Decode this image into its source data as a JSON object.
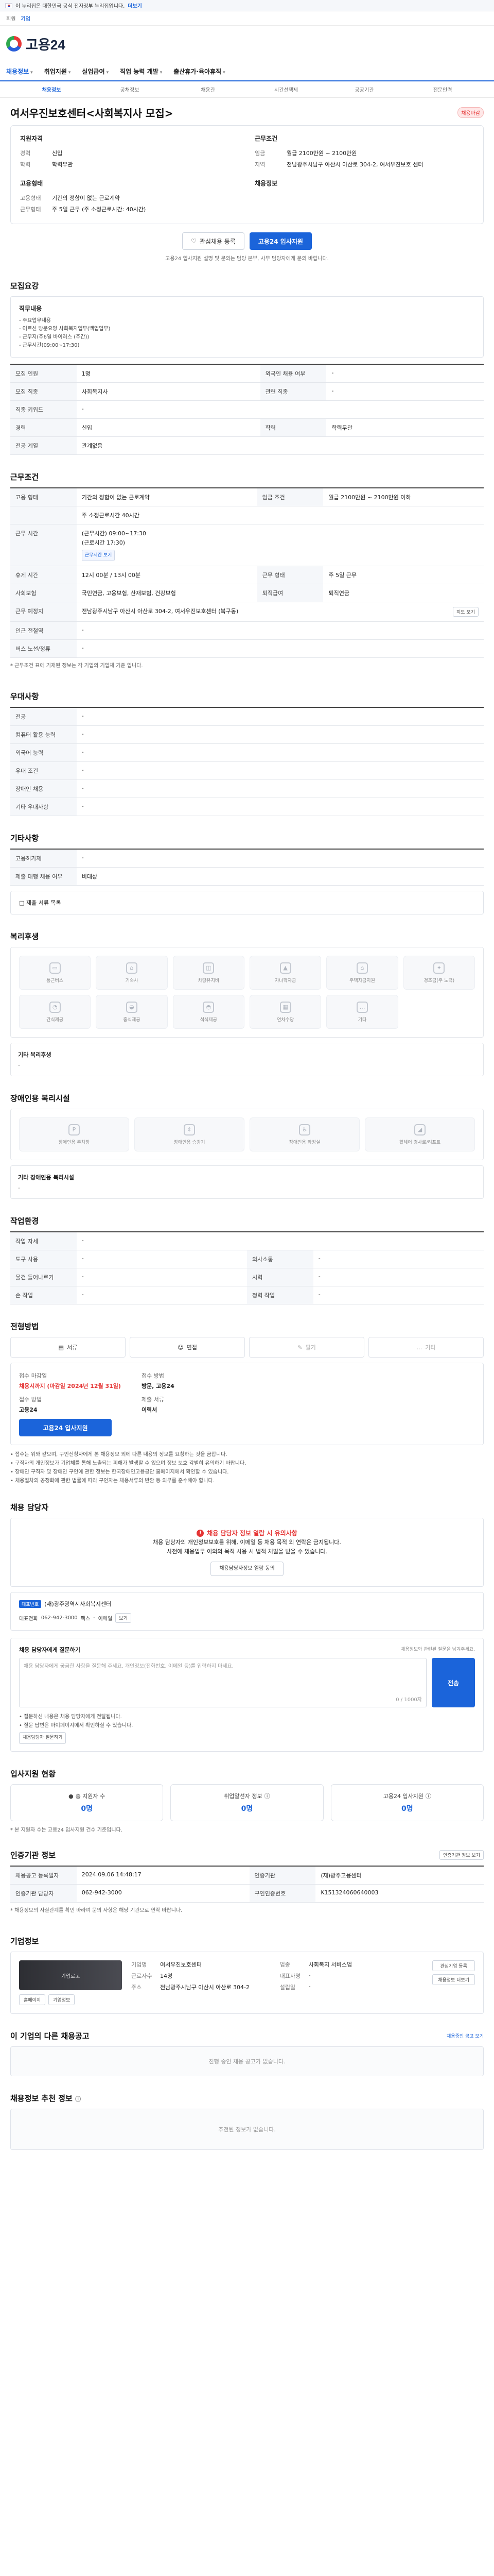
{
  "gov_bar": {
    "notice": "이 누리집은 대한민국 공식 전자정부 누리집입니다.",
    "link": "더보기"
  },
  "toolbar": {
    "items": [
      "회원",
      "기업"
    ]
  },
  "logo": {
    "text": "고용24"
  },
  "gnb": [
    "채용정보",
    "취업지원",
    "실업급여",
    "직업 능력 개발",
    "출산휴가·육아휴직"
  ],
  "subnav": [
    "채용정보",
    "공채정보",
    "채용관",
    "시간선택제",
    "공공기관",
    "전문인력"
  ],
  "title": "여서우진보호센터<사회복지사 모집>",
  "title_badge": "채용마감",
  "top_card": {
    "left_title": "지원자격",
    "left": [
      {
        "k": "경력",
        "v": "신입"
      },
      {
        "k": "학력",
        "v": "학력무관"
      }
    ],
    "left2_title": "고용형태",
    "left2": [
      {
        "k": "고용형태",
        "v": "기간의 정함이 없는 근로계약"
      },
      {
        "k": "근무형태",
        "v": "주 5일 근무 (주 소정근로시간: 40시간)"
      }
    ],
    "right_title": "근무조건",
    "right": [
      {
        "k": "임금",
        "v": "월급 2100만원 ~ 2100만원"
      },
      {
        "k": "지역",
        "v": "전남광주시남구 아산시 아산로 304-2, 여서우진보호 센터"
      }
    ],
    "right2_title": "채용정보"
  },
  "buttons": {
    "scrap": "관심채용 등록",
    "apply": "고용24 입사지원"
  },
  "apply_note": "고용24 입사지원 설명 및 문의는 담당 본부, 사무 담당자에게 문의 바랍니다.",
  "recruit": {
    "title": "모집요강",
    "box_title": "직무내용",
    "box_lines": [
      "- 주요업무내용",
      "- 어르신 방문요양 사회복지업무(백업업무)",
      "- 근무지(주6일 바이러스 (주간))",
      "- 근무시간(09:00~17:30)"
    ],
    "rows": [
      {
        "k": "모집 인원",
        "v": "1명",
        "k2": "외국인 채용 여부",
        "v2": "-"
      },
      {
        "k": "모집 직종",
        "v": "사회복지사",
        "k2": "관련 직종",
        "v2": "-"
      },
      {
        "k": "직종 키워드",
        "v": "-",
        "k2": "",
        "v2": ""
      },
      {
        "k": "경력",
        "v": "신입",
        "k2": "학력",
        "v2": "학력무관"
      },
      {
        "k": "전공 계열",
        "v": "관계없음",
        "k2": "",
        "v2": ""
      }
    ]
  },
  "conditions": {
    "title": "근무조건",
    "rows": [
      {
        "k": "고용 형태",
        "v": "기간의 정함이 없는 근로계약",
        "k2": "임금 조건",
        "v2": "월급 2100만원 ~ 2100만원 이하"
      },
      {
        "k": "",
        "v": "주 소정근로시간 40시간"
      },
      {
        "k": "근무 시간",
        "v": "(근무시간) 09:00~17:30",
        "extra": "(근로시간 17:30)",
        "tag": "근무시간 보기"
      },
      {
        "k": "휴게 시간",
        "v": "12시 00분 / 13시 00분",
        "k2": "근무 형태",
        "v2": "주 5일 근무"
      },
      {
        "k": "사회보험",
        "v": "국민연금, 고용보험, 산재보험, 건강보험",
        "k2": "퇴직급여",
        "v2": "퇴직연금"
      },
      {
        "k": "근무 예정지",
        "v": "전남광주시남구 아산시 아산로 304-2, 여서우진보호센터 (북구동)",
        "btn": "지도 보기"
      },
      {
        "k": "인근 전철역",
        "v": "-"
      },
      {
        "k": "버스 노선/정류",
        "v": "-"
      }
    ],
    "note": "* 근무조건 표에 기재된 정보는 각 기업의 기업체 기준 입니다."
  },
  "preference": {
    "title": "우대사항",
    "rows": [
      {
        "k": "전공",
        "v": "-"
      },
      {
        "k": "컴퓨터 활용 능력",
        "v": "-"
      },
      {
        "k": "외국어 능력",
        "v": "-"
      },
      {
        "k": "우대 조건",
        "v": "-"
      },
      {
        "k": "장애인 채용",
        "v": "-"
      },
      {
        "k": "기타 우대사항",
        "v": "-"
      }
    ]
  },
  "etc": {
    "title": "기타사항",
    "rows": [
      {
        "k": "고용허가제",
        "v": "-"
      },
      {
        "k": "제출 대행 채용 여부",
        "v": "비대상"
      }
    ],
    "sub": "□ 제출 서류 목록"
  },
  "welfare": {
    "title": "복리후생",
    "items": [
      "통근버스",
      "기숙사",
      "차량유지비",
      "자녀학자금",
      "주택자금지원",
      "경조금(주 노력)",
      "간식제공",
      "중식제공",
      "석식제공",
      "연차수당",
      "기타"
    ],
    "sub_title": "기타 복리후생",
    "sub_value": "-"
  },
  "facility": {
    "title": "장애인용 복리시설",
    "items": [
      "장애인용 주차장",
      "장애인용 승강기",
      "장애인용 화장실",
      "휠체어 경사로/리프트"
    ],
    "sub_title": "기타 장애인용 복리시설",
    "sub_value": "-"
  },
  "workenv": {
    "title": "작업환경",
    "rows": [
      {
        "k": "작업 자세",
        "v": "-"
      },
      {
        "k": "도구 사용",
        "v": "-",
        "k2": "의사소통",
        "v2": "-"
      },
      {
        "k": "물건 들어나르기",
        "v": "-",
        "k2": "시력",
        "v2": "-"
      },
      {
        "k": "손 작업",
        "v": "-",
        "k2": "청력 작업",
        "v2": "-"
      }
    ]
  },
  "process": {
    "title": "전형방법",
    "tabs": [
      "서류",
      "면접",
      "필기",
      "기타"
    ],
    "left": [
      {
        "k": "접수 마감일",
        "v": "채용시까지 (마감일 2024년 12월 31일)"
      },
      {
        "k": "접수 방법",
        "v": "고용24"
      }
    ],
    "right": [
      {
        "k": "접수 방법",
        "v": "방문, 고용24"
      },
      {
        "k": "제출 서류",
        "v": "이력서"
      }
    ],
    "apply_btn": "고용24 입사지원",
    "notes": [
      "• 접수는 위와 같으며, 구인신청자에게 본 채용정보 외에 다른 내용의 정보를 요청하는 것을 금합니다.",
      "• 구직자의 개인정보가 기업체를 통해 노출되는 피해가 발생할 수 있으며 정보 보호 각별히 유의하기 바랍니다.",
      "• 장애인 구직자 및 장애인 구인에 관한 정보는 한국장애인고용공단 홈페이지에서 확인할 수 있습니다.",
      "• 채용절차의 공정화에 관한 법률에 따라 구인자는 채용서류의 반환 등 의무를 준수해야 합니다."
    ]
  },
  "manager": {
    "title": "채용 담당자",
    "warn_title": "채용 담당자 정보 열람 시 유의사항",
    "warn_lines": [
      "채용 담당자의 개인정보보호를 위해, 이메일 등 채용 목적 외 연락은 금지됩니다.",
      "사전에 채용업무 이외의 목적 사용 시 법적 처벌을 받을 수 있습니다."
    ],
    "warn_btn": "채용담당자정보 열람 동의",
    "tag": "대표번호",
    "company": "(재)광주광역시사회복지센터",
    "phone_label": "대표전화",
    "phone": "062-942-3000",
    "fax_label": "팩스",
    "fax": "-",
    "email_label": "이메일",
    "email_btn": "보기",
    "inquiry_title": "채용 담당자에게 질문하기",
    "inquiry_note": "채용정보와 관련된 질문을 남겨주세요.",
    "inquiry_placeholder": "채용 담당자에게 궁금한 사항을 질문해 주세요. 개인정보(전화번호, 이메일 등)를 입력하지 마세요.",
    "inquiry_count": "0 / 1000자",
    "inquiry_btn": "전송",
    "inquiry_bullets": [
      "• 질문하신 내용은 채용 담당자에게 전달됩니다.",
      "• 질문 답변은 마이페이지에서 확인하실 수 있습니다."
    ],
    "inquiry_more": "채용담당자 질문하기"
  },
  "status": {
    "title": "입사지원 현황",
    "cards": [
      {
        "label": "총 지원자 수",
        "value": "0명"
      },
      {
        "label": "취업알선자 정보",
        "value": "0명"
      },
      {
        "label": "고용24 입사지원",
        "value": "0명"
      }
    ],
    "note": "* 본 지원자 수는 고용24 입사지원 건수 기준입니다."
  },
  "admin": {
    "title": "인증기관 정보",
    "btn": "인증기관 정보 보기",
    "rows": [
      {
        "k": "채용공고 등록일자",
        "v": "2024.09.06 14:48:17",
        "k2": "인증기관",
        "v2": "(재)광주고용센터"
      },
      {
        "k": "인증기관 담당자",
        "v": "062-942-3000",
        "k2": "구인인증번호",
        "v2": "K151324060640003"
      }
    ],
    "note": "* 채용정보의 사실관계를 확인 바라며 문의 사항은 해당 기관으로 연락 바랍니다."
  },
  "company": {
    "title": "기업정보",
    "logo_alt": "기업로고",
    "logo_btns": [
      "홈페이지",
      "기업정보"
    ],
    "kv": [
      {
        "k": "기업명",
        "v": "여서우진보호센터"
      },
      {
        "k": "업종",
        "v": "사회복지 서비스업"
      },
      {
        "k": "근로자수",
        "v": "14명"
      },
      {
        "k": "대표자명",
        "v": "-"
      },
      {
        "k": "주소",
        "v": "전남광주시남구 아산시 아산로 304-2"
      },
      {
        "k": "설립일",
        "v": "-"
      }
    ],
    "side_btns": [
      "관심기업 등록",
      "채용정보 더보기"
    ]
  },
  "other_jobs": {
    "title": "이 기업의 다른 채용공고",
    "link": "채용중인 공고 보기",
    "empty": "진행 중인 채용 공고가 없습니다."
  },
  "recommend": {
    "title": "채용정보 추천 정보",
    "empty": "추천된 정보가 없습니다."
  }
}
